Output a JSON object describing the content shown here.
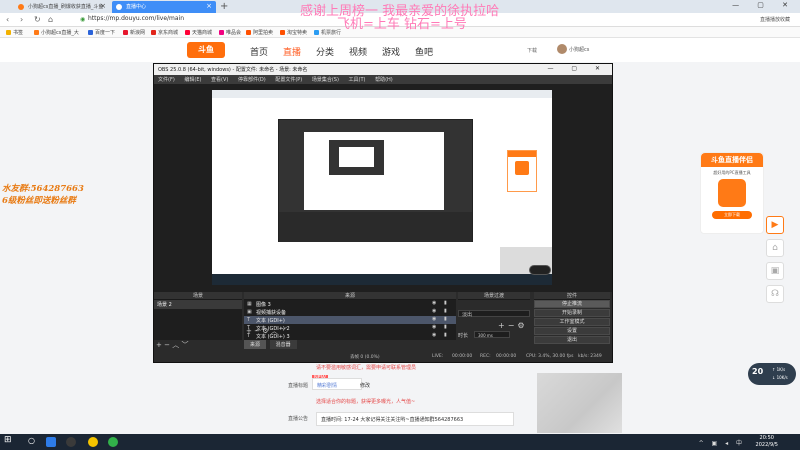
{
  "browser": {
    "tabs": [
      {
        "label": "小狗超cs直播_刷爆收获直播_斗鱼",
        "active": false
      },
      {
        "label": "直播中心",
        "active": true
      }
    ],
    "url": "https://mp.douyu.com/live/main",
    "bookmark_right": "直播播放收藏",
    "bookmarks": [
      "书签",
      "小狗超cs直播_大",
      "百度一下",
      "新浪网",
      "京东商城",
      "天猫商城",
      "唯品会",
      "阿里拍卖",
      "淘宝特卖",
      "机票旅行"
    ]
  },
  "douyu": {
    "logo": "斗鱼",
    "nav": [
      "首页",
      "直播",
      "分类",
      "视频",
      "游戏",
      "鱼吧"
    ],
    "active_nav": "直播",
    "download": "下载",
    "username": "小狗超cs"
  },
  "overlays": {
    "pink_line1": "感谢上周榜一 我最亲爱的徐执拉哈",
    "pink_line2": "飞机=上车 钻石=上号",
    "orange_line1": "水友群:564287663",
    "orange_line2": "6级粉丝即送粉丝群"
  },
  "promo": {
    "title": "斗鱼直播伴侣",
    "subtitle": "超好用的PC直播工具",
    "button": "立即下载"
  },
  "network": {
    "ping": "20",
    "up": "↑ 1K/s",
    "down": "↓ 10K/s"
  },
  "form": {
    "tip": "请不要滥用敏感词汇，需要申请可联系管理员",
    "label_title": "直播标题",
    "tag_new": "NEW",
    "title_value": "精彩剧情",
    "edit_btn": "修改",
    "hint": "选择适合你的标题，获得更多曝光，人气值~",
    "label_notice": "直播公告",
    "notice_value": "直播时间: 17-24 大家记得关注关注哟~直播通知群564287663"
  },
  "obs": {
    "title": "OBS 25.0.8 (64-bit, windows) - 配置文件: 未命名 - 场景: 未命名",
    "menu": [
      "文件(F)",
      "编辑(E)",
      "查看(V)",
      "停靠部件(D)",
      "配置文件(P)",
      "场景集合(S)",
      "工具(T)",
      "帮助(H)"
    ],
    "dock_headers": {
      "scenes": "场景",
      "sources": "来源",
      "transitions": "场景过渡",
      "controls": "控件"
    },
    "scenes": [
      "场景 2"
    ],
    "sources": [
      {
        "icon": "image-icon",
        "label": "图像 3",
        "selected": false
      },
      {
        "icon": "video-icon",
        "label": "视频捕获设备",
        "selected": false
      },
      {
        "icon": "text-icon",
        "label": "文本 (GDI+)",
        "selected": true
      },
      {
        "icon": "text-icon",
        "label": "文本 (GDI+) 2",
        "selected": false
      },
      {
        "icon": "text-icon",
        "label": "文本 (GDI+) 3",
        "selected": false
      }
    ],
    "transition": {
      "select": "淡出",
      "duration_label": "时长",
      "duration": "300 ms"
    },
    "controls": [
      "停止推流",
      "开始录制",
      "工作室模式",
      "设置",
      "退出"
    ],
    "dock_tabs": [
      "来源",
      "混音器"
    ],
    "status": {
      "drop": "丢帧 0 (0.0%)",
      "live_label": "LIVE:",
      "live_time": "00:00:00",
      "rec_label": "REC:",
      "rec_time": "00:00:00",
      "cpu": "CPU: 3.4%, 30.00 fps",
      "kbps": "kb/s: 2349"
    }
  },
  "taskbar": {
    "time": "20:50",
    "date": "2022/9/5"
  },
  "colors": {
    "accent": "#ff7a16",
    "tab_active": "#3f8ef7",
    "pink": "#ff7ab7",
    "orange_text": "#e87b14",
    "red_hint": "#e54848"
  }
}
